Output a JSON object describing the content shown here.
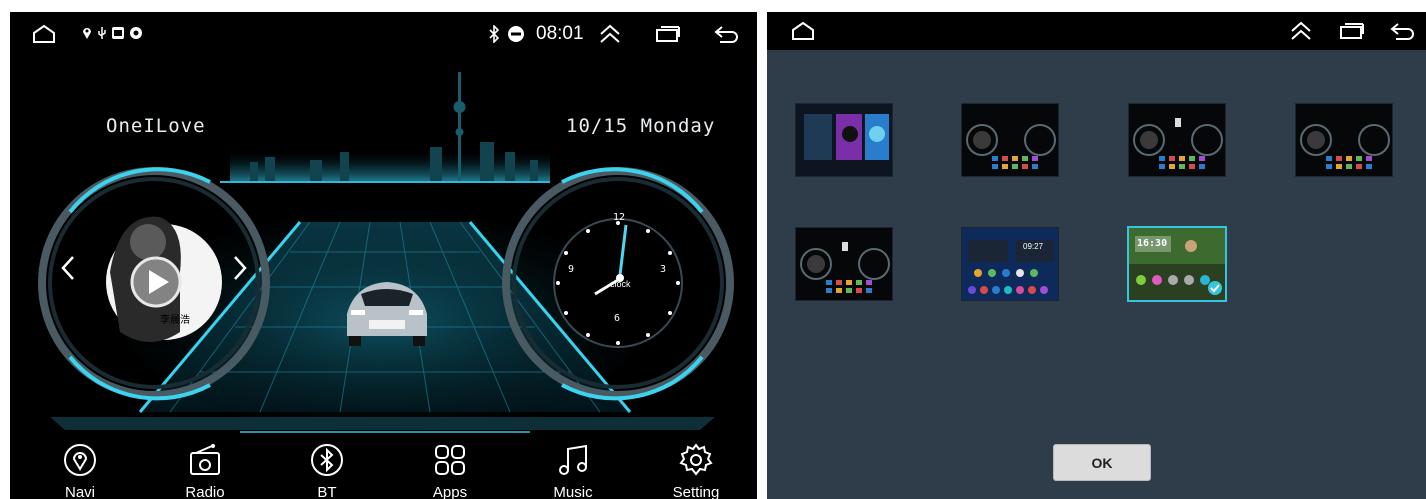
{
  "left_screen": {
    "status": {
      "time": "08:01"
    },
    "greeting": "OneILove",
    "date": "10/15 Monday",
    "music": {
      "album_text": "李晨浩"
    },
    "clock": {
      "label": "clock",
      "numbers": [
        "12",
        "3",
        "6",
        "9"
      ]
    },
    "dock": [
      {
        "label": "Navi",
        "icon": "location-pin-icon"
      },
      {
        "label": "Radio",
        "icon": "radio-icon"
      },
      {
        "label": "BT",
        "icon": "bluetooth-icon"
      },
      {
        "label": "Apps",
        "icon": "apps-grid-icon"
      },
      {
        "label": "Music",
        "icon": "music-note-icon"
      },
      {
        "label": "Setting",
        "icon": "settings-gear-icon"
      }
    ]
  },
  "right_screen": {
    "theme_thumbnails": [
      {
        "name": "theme-1",
        "selected": false
      },
      {
        "name": "theme-2",
        "selected": false
      },
      {
        "name": "theme-3",
        "selected": false
      },
      {
        "name": "theme-4",
        "selected": false
      },
      {
        "name": "theme-5",
        "selected": false
      },
      {
        "name": "theme-6",
        "selected": false,
        "time_text": "09:27"
      },
      {
        "name": "theme-7",
        "selected": true,
        "time_text": "16:30"
      }
    ],
    "ok_label": "OK"
  },
  "colors": {
    "accent_cyan": "#37c5dd",
    "right_background": "#2f3d4b"
  }
}
